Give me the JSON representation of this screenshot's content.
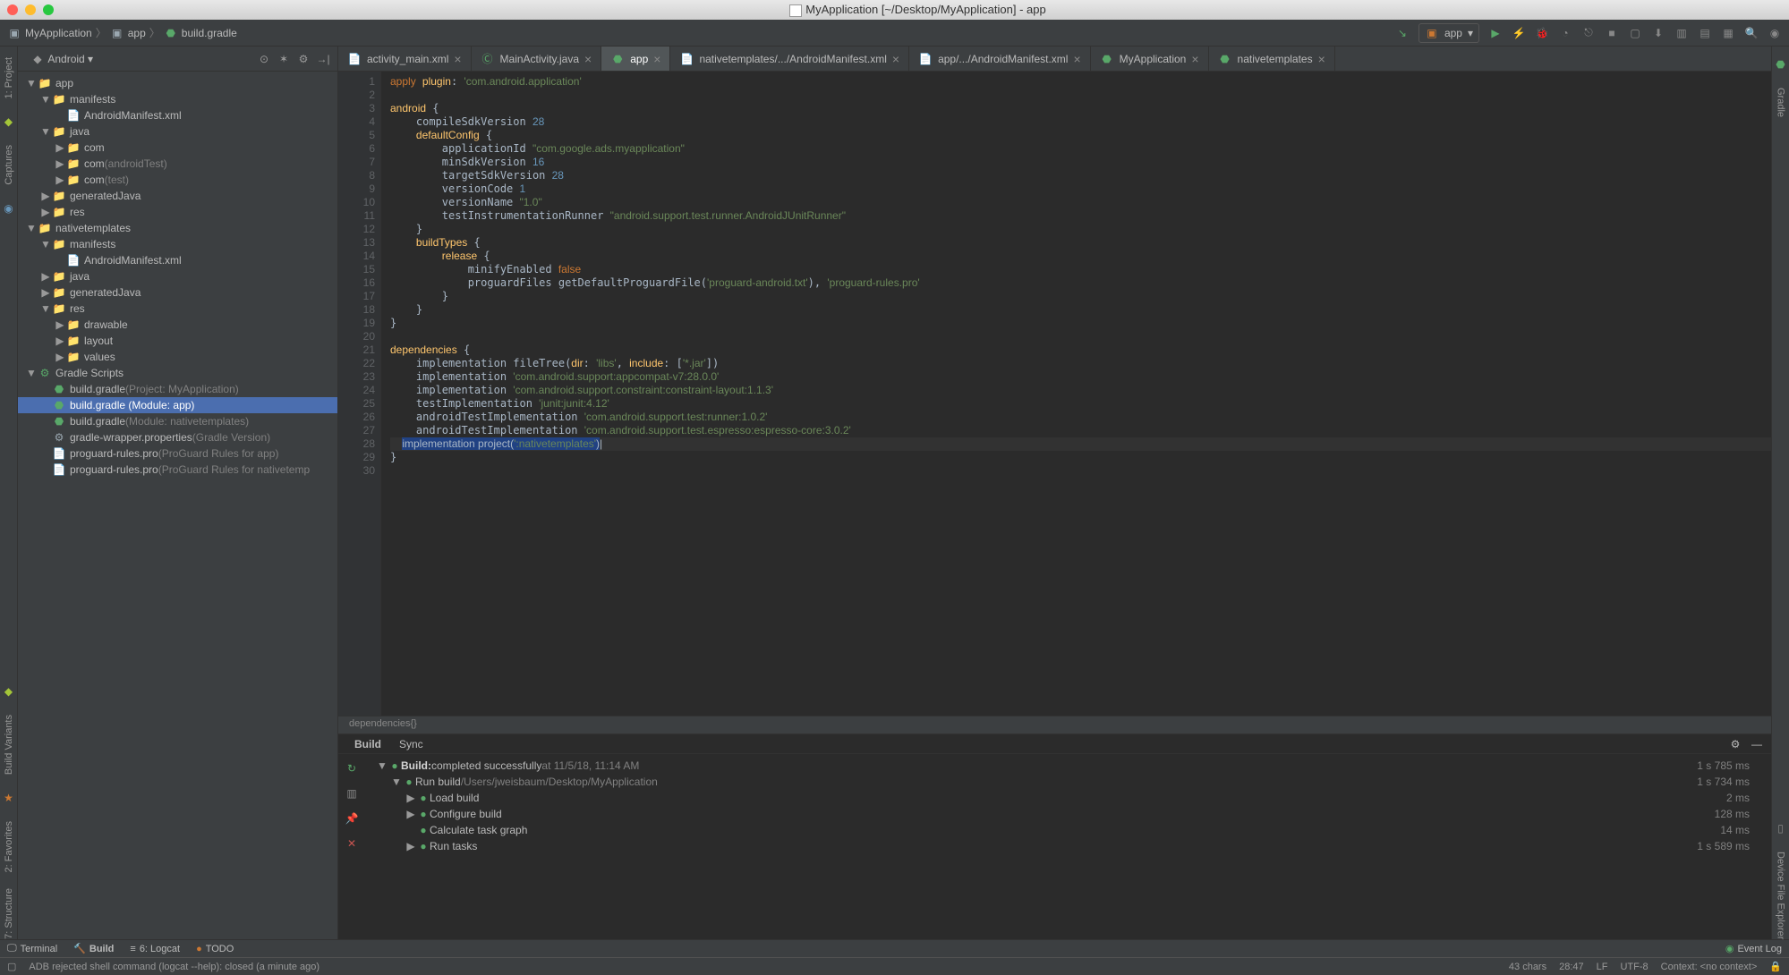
{
  "title": "MyApplication [~/Desktop/MyApplication] - app",
  "breadcrumb": {
    "project": "MyApplication",
    "module": "app",
    "file": "build.gradle"
  },
  "run_config": "app",
  "project_view": {
    "header": "Android",
    "tree": [
      {
        "d": 0,
        "exp": "▼",
        "icon": "📁",
        "label": "app"
      },
      {
        "d": 1,
        "exp": "▼",
        "icon": "📁",
        "label": "manifests"
      },
      {
        "d": 2,
        "exp": "",
        "icon": "📄",
        "label": "AndroidManifest.xml",
        "iconcls": "xml"
      },
      {
        "d": 1,
        "exp": "▼",
        "icon": "📁",
        "label": "java"
      },
      {
        "d": 2,
        "exp": "▶",
        "icon": "📁",
        "label": "com"
      },
      {
        "d": 2,
        "exp": "▶",
        "icon": "📁",
        "label": "com",
        "suffix": "(androidTest)"
      },
      {
        "d": 2,
        "exp": "▶",
        "icon": "📁",
        "label": "com",
        "suffix": "(test)"
      },
      {
        "d": 1,
        "exp": "▶",
        "icon": "📁",
        "label": "generatedJava"
      },
      {
        "d": 1,
        "exp": "▶",
        "icon": "📁",
        "label": "res"
      },
      {
        "d": 0,
        "exp": "▼",
        "icon": "📁",
        "label": "nativetemplates"
      },
      {
        "d": 1,
        "exp": "▼",
        "icon": "📁",
        "label": "manifests"
      },
      {
        "d": 2,
        "exp": "",
        "icon": "📄",
        "label": "AndroidManifest.xml",
        "iconcls": "xml"
      },
      {
        "d": 1,
        "exp": "▶",
        "icon": "📁",
        "label": "java"
      },
      {
        "d": 1,
        "exp": "▶",
        "icon": "📁",
        "label": "generatedJava"
      },
      {
        "d": 1,
        "exp": "▼",
        "icon": "📁",
        "label": "res"
      },
      {
        "d": 2,
        "exp": "▶",
        "icon": "📁",
        "label": "drawable"
      },
      {
        "d": 2,
        "exp": "▶",
        "icon": "📁",
        "label": "layout"
      },
      {
        "d": 2,
        "exp": "▶",
        "icon": "📁",
        "label": "values"
      },
      {
        "d": 0,
        "exp": "▼",
        "icon": "⚙",
        "label": "Gradle Scripts",
        "iconcls": "gradle"
      },
      {
        "d": 1,
        "exp": "",
        "icon": "⬣",
        "label": "build.gradle",
        "suffix": "(Project: MyApplication)",
        "iconcls": "gradle"
      },
      {
        "d": 1,
        "exp": "",
        "icon": "⬣",
        "label": "build.gradle (Module: app)",
        "iconcls": "gradle",
        "selected": true
      },
      {
        "d": 1,
        "exp": "",
        "icon": "⬣",
        "label": "build.gradle",
        "suffix": "(Module: nativetemplates)",
        "iconcls": "gradle"
      },
      {
        "d": 1,
        "exp": "",
        "icon": "⚙",
        "label": "gradle-wrapper.properties",
        "suffix": "(Gradle Version)"
      },
      {
        "d": 1,
        "exp": "",
        "icon": "📄",
        "label": "proguard-rules.pro",
        "suffix": "(ProGuard Rules for app)"
      },
      {
        "d": 1,
        "exp": "",
        "icon": "📄",
        "label": "proguard-rules.pro",
        "suffix": "(ProGuard Rules for nativetemp"
      }
    ]
  },
  "tabs": [
    {
      "label": "activity_main.xml",
      "icon": "📄",
      "iconcls": "xml"
    },
    {
      "label": "MainActivity.java",
      "icon": "Ⓒ",
      "iconcls": "gradle"
    },
    {
      "label": "app",
      "icon": "⬣",
      "iconcls": "gradle",
      "active": true
    },
    {
      "label": "nativetemplates/.../AndroidManifest.xml",
      "icon": "📄",
      "iconcls": "xml"
    },
    {
      "label": "app/.../AndroidManifest.xml",
      "icon": "📄",
      "iconcls": "xml"
    },
    {
      "label": "MyApplication",
      "icon": "⬣",
      "iconcls": "gradle"
    },
    {
      "label": "nativetemplates",
      "icon": "⬣",
      "iconcls": "gradle"
    }
  ],
  "code_lines": 30,
  "crumb_path": "dependencies{}",
  "build_header": {
    "tab1": "Build",
    "tab2": "Sync"
  },
  "build_rows": [
    {
      "d": 0,
      "exp": "▼",
      "ok": true,
      "boldlabel": "Build:",
      "label": " completed successfully",
      "suffix": "   at 11/5/18, 11:14 AM",
      "time": "1 s 785 ms"
    },
    {
      "d": 1,
      "exp": "▼",
      "ok": true,
      "label": "Run build",
      "suffix": "  /Users/jweisbaum/Desktop/MyApplication",
      "time": "1 s 734 ms"
    },
    {
      "d": 2,
      "exp": "▶",
      "ok": true,
      "label": "Load build",
      "time": "2 ms"
    },
    {
      "d": 2,
      "exp": "▶",
      "ok": true,
      "label": "Configure build",
      "time": "128 ms"
    },
    {
      "d": 2,
      "exp": "",
      "ok": true,
      "label": "Calculate task graph",
      "time": "14 ms"
    },
    {
      "d": 2,
      "exp": "▶",
      "ok": true,
      "label": "Run tasks",
      "time": "1 s 589 ms"
    }
  ],
  "left_stripe": [
    "1: Project",
    "Captures"
  ],
  "left_stripe2": [
    "Build Variants",
    "2: Favorites",
    "7: Structure"
  ],
  "right_stripe": [
    "Gradle",
    "Device File Explorer"
  ],
  "dock": {
    "terminal": "Terminal",
    "build": "Build",
    "logcat": "6: Logcat",
    "todo": "TODO",
    "eventlog": "Event Log"
  },
  "status": {
    "msg": "ADB rejected shell command (logcat --help): closed (a minute ago)",
    "chars": "43 chars",
    "pos": "28:47",
    "lf": "LF",
    "enc": "UTF-8",
    "ctx": "Context: <no context>"
  }
}
